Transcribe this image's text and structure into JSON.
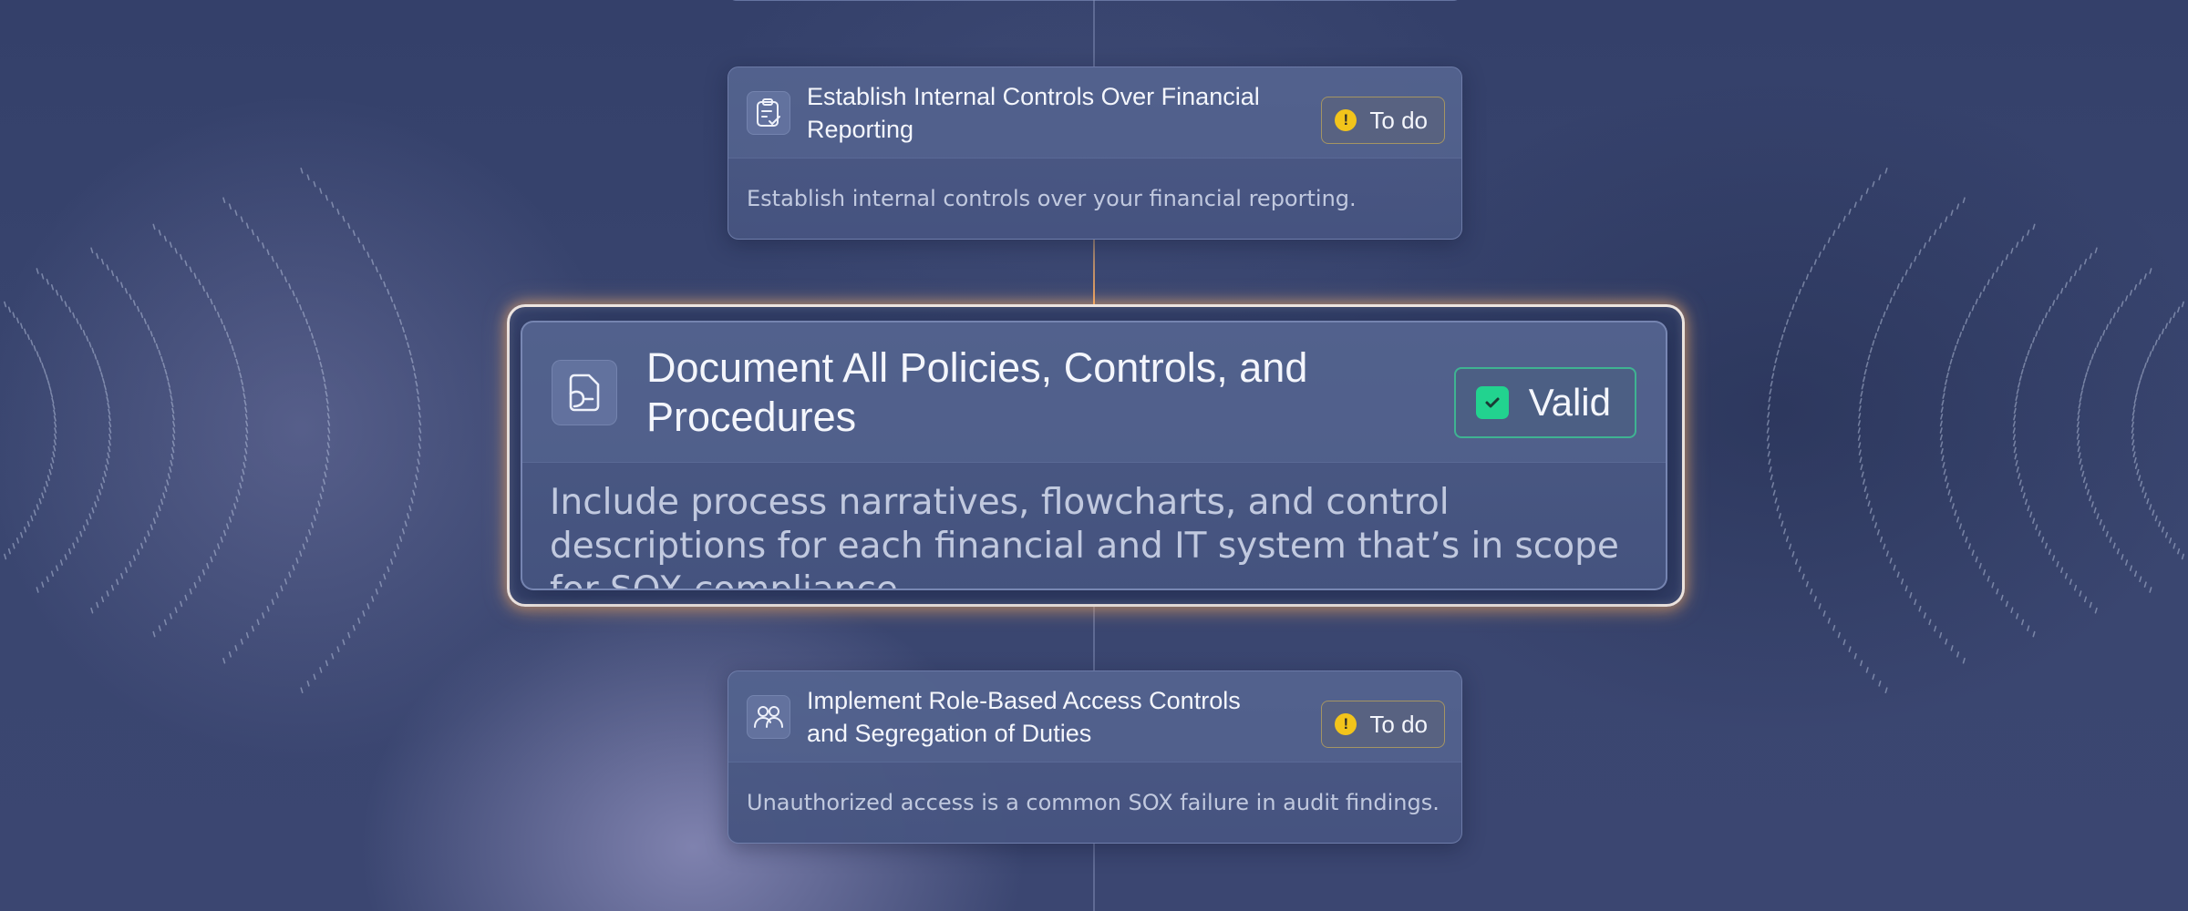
{
  "steps": [
    {
      "title": "Establish Internal Controls Over Financial Reporting",
      "description": "Establish internal controls over your financial reporting.",
      "status": "To do",
      "status_icon": "exclamation-circle-icon",
      "icon": "clipboard-check-icon"
    },
    {
      "title": "Document All Policies, Controls, and Procedures",
      "description": "Include process narratives, flowcharts, and control descriptions for each financial and IT system that’s in scope for SOX compliance",
      "status": "Valid",
      "status_icon": "check-icon",
      "icon": "document-icon"
    },
    {
      "title": "Implement Role-Based Access Controls and Segregation of Duties",
      "description": "Unauthorized access is a common SOX failure in audit findings.",
      "status": "To do",
      "status_icon": "exclamation-circle-icon",
      "icon": "users-icon"
    }
  ],
  "colors": {
    "todo": "#f2c41b",
    "valid": "#22d38f",
    "focus_glow": "#ffb060"
  }
}
